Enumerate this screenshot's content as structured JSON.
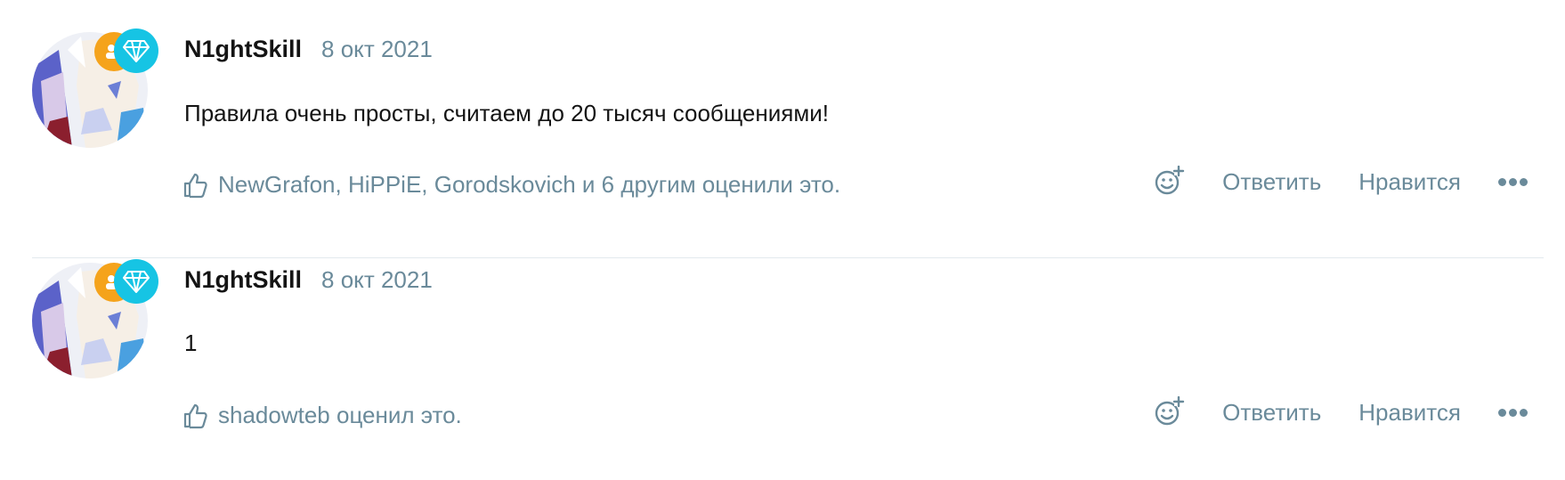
{
  "posts": [
    {
      "author": "N1ghtSkill",
      "date": "8 окт 2021",
      "message": "Правила очень просты, считаем до 20 тысяч сообщениями!",
      "reactions_text": "NewGrafon, HiPPiE, Gorodskovich и 6 другим оценили это.",
      "actions": {
        "reply": "Ответить",
        "like": "Нравится"
      }
    },
    {
      "author": "N1ghtSkill",
      "date": "8 окт 2021",
      "message": "1",
      "reactions_text": "shadowteb оценил это.",
      "actions": {
        "reply": "Ответить",
        "like": "Нравится"
      }
    }
  ],
  "colors": {
    "muted": "#6a8a9a",
    "badge_orange": "#f5a31b",
    "badge_diamond": "#16c4e4",
    "divider": "#e3eaee"
  },
  "icons": [
    "avatar-image",
    "user-group-badge-icon",
    "diamond-badge-icon",
    "thumbs-up-icon",
    "add-reaction-icon",
    "more-options-icon"
  ]
}
